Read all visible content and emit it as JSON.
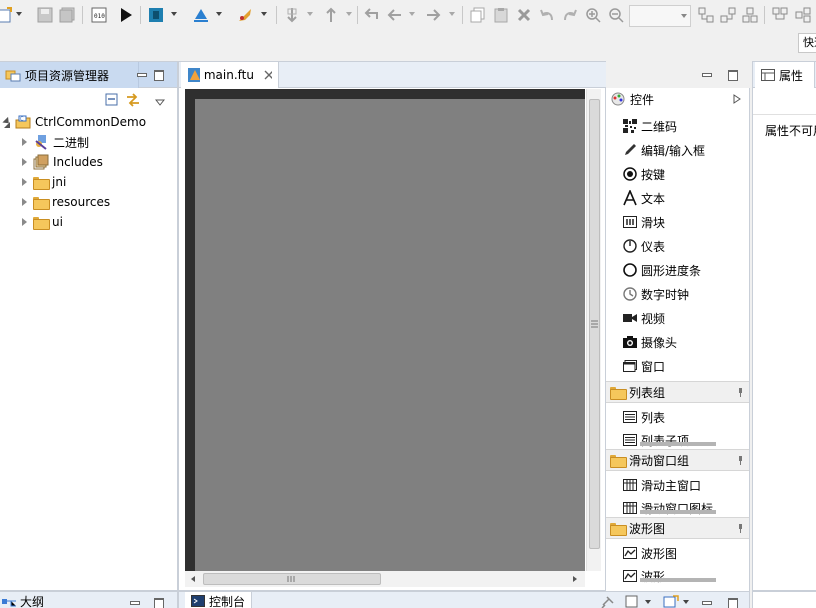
{
  "toolbar": {
    "quick_access": "快速访问"
  },
  "explorer": {
    "tab_label": "项目资源管理器",
    "tree": [
      {
        "label": "CtrlCommonDemo",
        "icon": "project-icon",
        "expanded": true
      },
      {
        "label": "二进制",
        "icon": "binaries-icon"
      },
      {
        "label": "Includes",
        "icon": "includes-icon"
      },
      {
        "label": "jni",
        "icon": "folder-icon"
      },
      {
        "label": "resources",
        "icon": "folder-icon"
      },
      {
        "label": "ui",
        "icon": "folder-icon"
      }
    ]
  },
  "editor": {
    "tab_label": "main.ftu",
    "canvas_color": "#808080",
    "frame_color": "#2f2f2f"
  },
  "palette": {
    "header": "控件",
    "controls": [
      {
        "label": "二维码",
        "icon": "qrcode-icon"
      },
      {
        "label": "编辑/输入框",
        "icon": "pencil-icon"
      },
      {
        "label": "按键",
        "icon": "radio-button-icon"
      },
      {
        "label": "文本",
        "icon": "text-icon"
      },
      {
        "label": "滑块",
        "icon": "slider-icon"
      },
      {
        "label": "仪表",
        "icon": "gauge-icon"
      },
      {
        "label": "圆形进度条",
        "icon": "circle-progress-icon"
      },
      {
        "label": "数字时钟",
        "icon": "clock-icon"
      },
      {
        "label": "视频",
        "icon": "video-icon"
      },
      {
        "label": "摄像头",
        "icon": "camera-icon"
      },
      {
        "label": "窗口",
        "icon": "window-icon"
      }
    ],
    "groups": [
      {
        "label": "列表组",
        "items": [
          {
            "label": "列表",
            "icon": "list-icon"
          },
          {
            "label": "列表子项",
            "icon": "list-icon"
          }
        ]
      },
      {
        "label": "滑动窗口组",
        "items": [
          {
            "label": "滑动主窗口",
            "icon": "grid-icon"
          },
          {
            "label": "滑动窗口图标",
            "icon": "grid-icon"
          }
        ]
      },
      {
        "label": "波形图",
        "items": [
          {
            "label": "波形图",
            "icon": "waveform-icon"
          },
          {
            "label": "波形",
            "icon": "waveform-icon"
          }
        ]
      }
    ]
  },
  "properties": {
    "tab_label": "属性",
    "message": "属性不可用"
  },
  "bottom": {
    "outline_label": "大纲",
    "console_label": "控制台"
  }
}
